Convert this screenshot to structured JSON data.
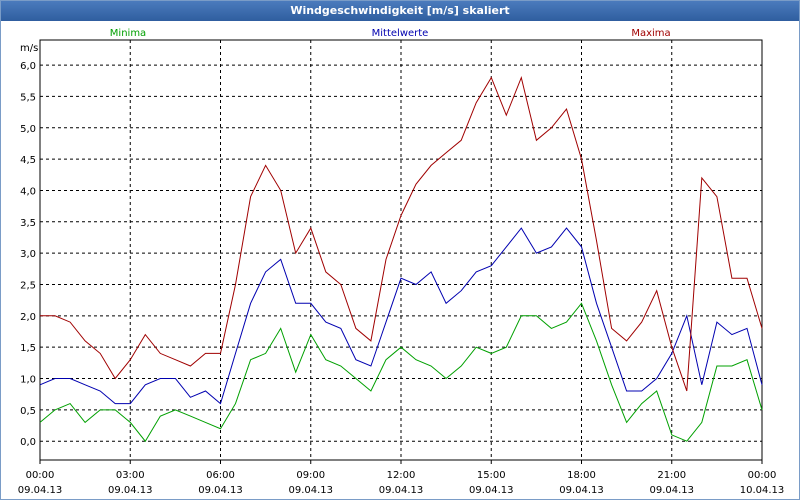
{
  "window": {
    "title": "Windgeschwindigkeit [m/s] skaliert"
  },
  "colors": {
    "min": "#00a000",
    "mean": "#0000b0",
    "max": "#a00000",
    "grid": "#000000"
  },
  "chart_data": {
    "type": "line",
    "title": "Windgeschwindigkeit [m/s] skaliert",
    "ylabel": "m/s",
    "ylim": [
      -0.3,
      6.4
    ],
    "yticks": [
      "0,0",
      "0,5",
      "1,0",
      "1,5",
      "2,0",
      "2,5",
      "3,0",
      "3,5",
      "4,0",
      "4,5",
      "5,0",
      "5,5",
      "6,0"
    ],
    "xlim": [
      "09.04.13 00:00",
      "10.04.13 00:00"
    ],
    "xticks": [
      {
        "time": "00:00",
        "date": "09.04.13"
      },
      {
        "time": "03:00",
        "date": "09.04.13"
      },
      {
        "time": "06:00",
        "date": "09.04.13"
      },
      {
        "time": "09:00",
        "date": "09.04.13"
      },
      {
        "time": "12:00",
        "date": "09.04.13"
      },
      {
        "time": "15:00",
        "date": "09.04.13"
      },
      {
        "time": "18:00",
        "date": "09.04.13"
      },
      {
        "time": "21:00",
        "date": "09.04.13"
      },
      {
        "time": "00:00",
        "date": "10.04.13"
      }
    ],
    "grid": true,
    "legend_placement": "top",
    "x_unit": "hours since 09.04.13 00:00",
    "series": [
      {
        "name": "Minima",
        "color": "#00a000",
        "x": [
          0,
          0.5,
          1,
          1.5,
          2,
          2.5,
          3,
          3.5,
          4,
          4.5,
          5,
          5.5,
          6,
          6.5,
          7,
          7.5,
          8,
          8.5,
          9,
          9.5,
          10,
          10.5,
          11,
          11.5,
          12,
          12.5,
          13,
          13.5,
          14,
          14.5,
          15,
          15.5,
          16,
          16.5,
          17,
          17.5,
          18,
          18.5,
          19,
          19.5,
          20,
          20.5,
          21,
          21.5,
          22,
          22.5,
          23,
          23.5,
          24
        ],
        "y": [
          0.3,
          0.5,
          0.6,
          0.3,
          0.5,
          0.5,
          0.3,
          0.0,
          0.4,
          0.5,
          0.4,
          0.3,
          0.2,
          0.6,
          1.3,
          1.4,
          1.8,
          1.1,
          1.7,
          1.3,
          1.2,
          1.0,
          0.8,
          1.3,
          1.5,
          1.3,
          1.2,
          1.0,
          1.2,
          1.5,
          1.4,
          1.5,
          2.0,
          2.0,
          1.8,
          1.9,
          2.2,
          1.6,
          0.9,
          0.3,
          0.6,
          0.8,
          0.1,
          0.0,
          0.3,
          1.2,
          1.2,
          1.3,
          0.5
        ]
      },
      {
        "name": "Mittelwerte",
        "color": "#0000b0",
        "x": [
          0,
          0.5,
          1,
          1.5,
          2,
          2.5,
          3,
          3.5,
          4,
          4.5,
          5,
          5.5,
          6,
          6.5,
          7,
          7.5,
          8,
          8.5,
          9,
          9.5,
          10,
          10.5,
          11,
          11.5,
          12,
          12.5,
          13,
          13.5,
          14,
          14.5,
          15,
          15.5,
          16,
          16.5,
          17,
          17.5,
          18,
          18.5,
          19,
          19.5,
          20,
          20.5,
          21,
          21.5,
          22,
          22.5,
          23,
          23.5,
          24
        ],
        "y": [
          0.9,
          1.0,
          1.0,
          0.9,
          0.8,
          0.6,
          0.6,
          0.9,
          1.0,
          1.0,
          0.7,
          0.8,
          0.6,
          1.4,
          2.2,
          2.7,
          2.9,
          2.2,
          2.2,
          1.9,
          1.8,
          1.3,
          1.2,
          1.9,
          2.6,
          2.5,
          2.7,
          2.2,
          2.4,
          2.7,
          2.8,
          3.1,
          3.4,
          3.0,
          3.1,
          3.4,
          3.1,
          2.2,
          1.5,
          0.8,
          0.8,
          1.0,
          1.4,
          2.0,
          0.9,
          1.9,
          1.7,
          1.8,
          0.9
        ]
      },
      {
        "name": "Maxima",
        "color": "#a00000",
        "x": [
          0,
          0.5,
          1,
          1.5,
          2,
          2.5,
          3,
          3.5,
          4,
          4.5,
          5,
          5.5,
          6,
          6.5,
          7,
          7.5,
          8,
          8.5,
          9,
          9.5,
          10,
          10.5,
          11,
          11.5,
          12,
          12.5,
          13,
          13.5,
          14,
          14.5,
          15,
          15.5,
          16,
          16.5,
          17,
          17.5,
          18,
          18.5,
          19,
          19.5,
          20,
          20.5,
          21,
          21.5,
          22,
          22.5,
          23,
          23.5,
          24
        ],
        "y": [
          2.0,
          2.0,
          1.9,
          1.6,
          1.4,
          1.0,
          1.3,
          1.7,
          1.4,
          1.3,
          1.2,
          1.4,
          1.4,
          2.5,
          3.9,
          4.4,
          4.0,
          3.0,
          3.4,
          2.7,
          2.5,
          1.8,
          1.6,
          2.9,
          3.6,
          4.1,
          4.4,
          4.6,
          4.8,
          5.4,
          5.8,
          5.2,
          5.8,
          4.8,
          5.0,
          5.3,
          4.5,
          3.2,
          1.8,
          1.6,
          1.9,
          2.4,
          1.5,
          0.8,
          4.2,
          3.9,
          2.6,
          2.6,
          1.8
        ]
      }
    ]
  }
}
